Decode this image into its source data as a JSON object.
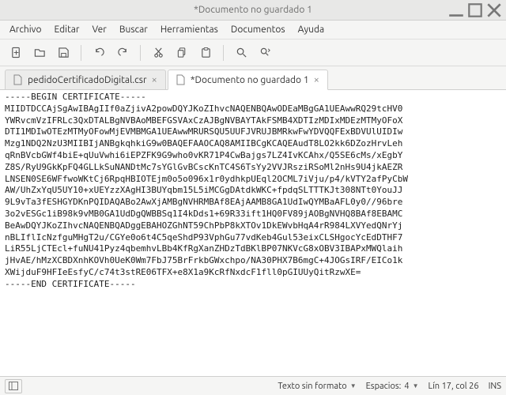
{
  "titlebar": {
    "title": "*Documento no guardado 1"
  },
  "menubar": {
    "items": [
      "Archivo",
      "Editar",
      "Ver",
      "Buscar",
      "Herramientas",
      "Documentos",
      "Ayuda"
    ]
  },
  "toolbar_icons": {
    "new": "new-file-icon",
    "open": "open-folder-icon",
    "save": "save-icon",
    "undo": "undo-icon",
    "redo": "redo-icon",
    "cut": "cut-icon",
    "copy": "copy-icon",
    "paste": "paste-icon",
    "find": "find-icon",
    "find_replace": "find-replace-icon"
  },
  "tabs": [
    {
      "label": "pedidoCertificadoDigital.csr",
      "active": false
    },
    {
      "label": "*Documento no guardado 1",
      "active": true
    }
  ],
  "editor": {
    "text": "-----BEGIN CERTIFICATE-----\nMIIDTDCCAjSgAwIBAgIIf0aZjivA2powDQYJKoZIhvcNAQENBQAwODEaMBgGA1UEAwwRQ29tcHV0\nYWRvcmVzIFRLc3QxDTALBgNVBAoMBEFGSVAxCzAJBgNVBAYTAkFSMB4XDTIzMDIxMDEzMTMyOFoX\nDTI1MDIwOTEzMTMyOFowMjEVMBMGA1UEAwwMRURSQU5UUFJVRUJBMRkwFwYDVQQFExBDVUlUIDIw\nMzg1NDQ2NzU3MIIBIjANBgkqhkiG9w0BAQEFAAOCAQ8AMIIBCgKCAQEAudT8LO2kk6DZozHrvLeh\nqRnBVcbGWf4biE+qUuVwhi6iEPZFK9G9who0vKR71P4CwBajgs7LZ4IvKCAhx/Q5SE6cMs/xEgbY\nZ8S/RyU9GkKpFQ4GLLkSuNANDtMc7sYGlGvBCscKnTC4S6TsYy2VVJRsziRSoMl2nHs9U4jkAEZR\nLNSEN0SE6WFfwoWKtCj6RpqHBIOTEjm0o5o096x1r0ydhkpUEql2OCML7iVju/p4/kVTY2afPyCbW\nAW/UhZxYqU5UY10+xUEYzzXAgHI3BUYqbm15L5iMCGgDAtdkWKC+fpdqSLTTTKJt308NTt0YouJJ\n9L9vTa3fESHGYDKnPQIDAQABo2AwXjAMBgNVHRMBAf8EAjAAMB8GA1UdIwQYMBaAFL0y0//96bre\n3o2vESGc1iB98k9vMB0GA1UdDgQWBBSq1I4kDds1+69R33ift1HQ0FV89jAOBgNVHQ8BAf8EBAMC\nBeAwDQYJKoZIhvcNAQENBQADggEBAHOZGhNT59ChPbP8kXTOv1DkEWvbHqA4rR984LXVYedQNrYj\nnBLIflIcNzfguMHgT2u/CGYe0o6t4C5qeShdP93VphGu77vdKeb4Gul53eixCLSHgocYcEdDTHF7\nLiR55LjCTEcl+fuNU41Pyz4qbemhvLBb4KfRgXanZHDzTdBKlBP07NKVcG8xOBV3IBAPxMWQlaih\njHvAE/hMzXCBDXnhKOVh0UeK0Wm7FbJ75BrFrkbGWxchpo/NA30PHX7B6mgC+4JOGsIRF/EICo1k\nXWijduF9HFIeEsfyC/c74t3stRE06TFX+e8X1a9KcRfNxdcF1fll0pGIUUyQitRzwXE=\n-----END CERTIFICATE-----"
  },
  "statusbar": {
    "plaintext": "Texto sin formato",
    "tabwidth_label": "Espacios:",
    "tabwidth_value": "4",
    "cursor": "Lín 17, col 26",
    "insert_mode": "INS"
  }
}
